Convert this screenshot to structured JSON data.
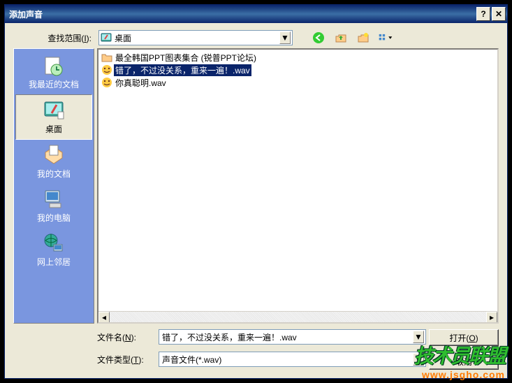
{
  "title": "添加声音",
  "lookin": {
    "label_pre": "查找范围(",
    "label_u": "I",
    "label_post": "):",
    "value": "桌面"
  },
  "sidebar": {
    "items": [
      {
        "label": "我最近的文档"
      },
      {
        "label": "桌面"
      },
      {
        "label": "我的文档"
      },
      {
        "label": "我的电脑"
      },
      {
        "label": "网上邻居"
      }
    ]
  },
  "files": [
    {
      "type": "folder",
      "name": "最全韩国PPT图表集合 (锐普PPT论坛)"
    },
    {
      "type": "wav",
      "name": "错了，不过没关系，重来一遍！.wav"
    },
    {
      "type": "wav",
      "name": "你真聪明.wav"
    }
  ],
  "filename": {
    "label_pre": "文件名(",
    "label_u": "N",
    "label_post": "):",
    "value": "错了，不过没关系，重来一遍！.wav"
  },
  "filetype": {
    "label_pre": "文件类型(",
    "label_u": "T",
    "label_post": "):",
    "value": "声音文件(*.wav)"
  },
  "buttons": {
    "open_pre": "打开(",
    "open_u": "O",
    "open_post": ")",
    "cancel": "取消"
  },
  "watermark": {
    "line1": "技术员联盟",
    "line2": "www.jsgho.com"
  }
}
